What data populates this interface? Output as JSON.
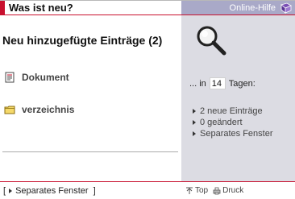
{
  "header": {
    "title": "Was ist neu?",
    "help_label": "Online-Hilfe"
  },
  "main": {
    "heading": "Neu hinzugefügte Einträge (2)",
    "items": [
      {
        "label": "Dokument",
        "icon": "document-icon"
      },
      {
        "label": "verzeichnis",
        "icon": "folder-icon"
      }
    ]
  },
  "panel": {
    "days_prefix": "... in",
    "days_value": "14",
    "days_suffix": "Tagen:",
    "stats": [
      "2 neue Einträge",
      "0 geändert",
      "Separates Fenster"
    ]
  },
  "footer": {
    "bracket_open": "[",
    "separate_window": "Separates Fenster",
    "bracket_close": "]",
    "top_label": "Top",
    "print_label": "Druck"
  },
  "colors": {
    "accent_red": "#c8102e",
    "header_right_bg": "#a9a9c8",
    "panel_bg": "#dcdce3"
  }
}
